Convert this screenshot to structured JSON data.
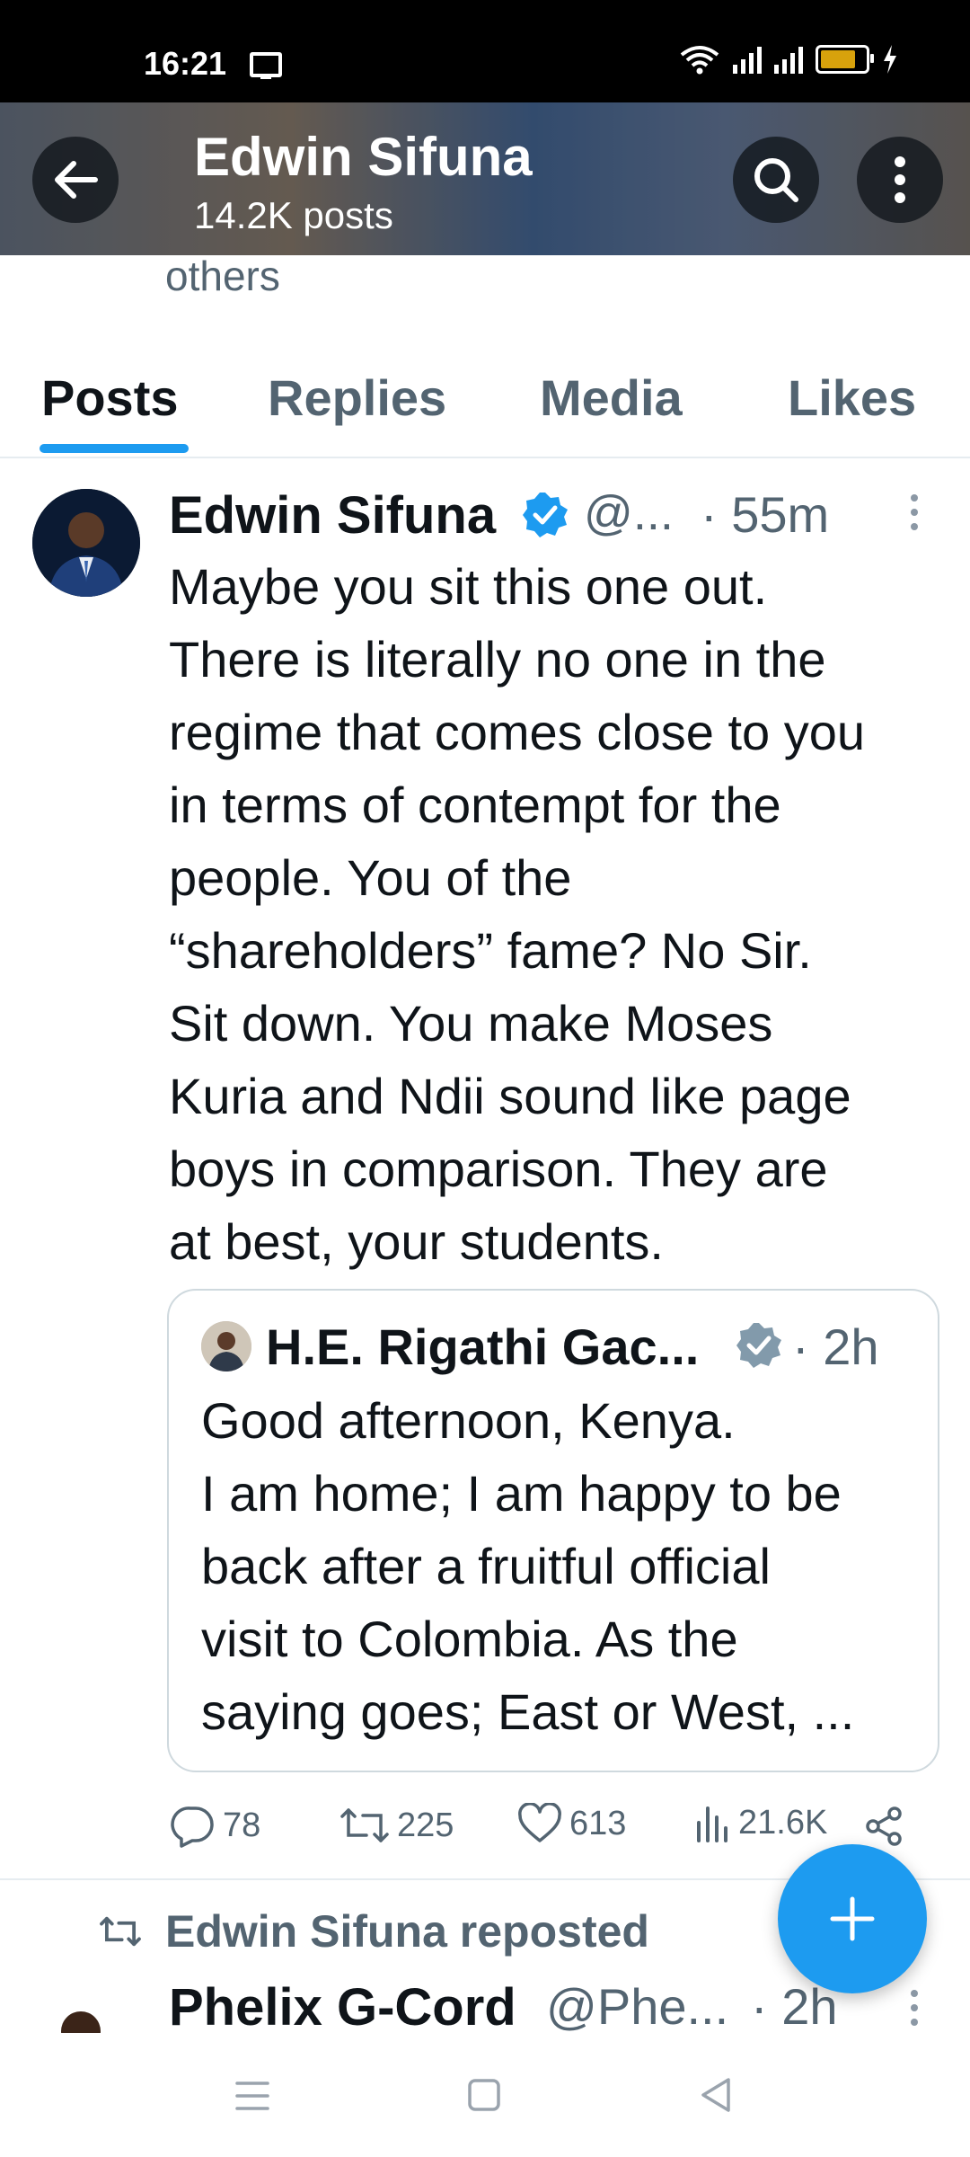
{
  "status_bar": {
    "time": "16:21",
    "battery_color": "#d8a20c"
  },
  "header": {
    "name": "Edwin Sifuna",
    "posts_count": "14.2K posts",
    "bio_fragment": "others"
  },
  "tabs": [
    {
      "label": "Posts",
      "active": true
    },
    {
      "label": "Replies",
      "active": false
    },
    {
      "label": "Media",
      "active": false
    },
    {
      "label": "Likes",
      "active": false
    }
  ],
  "tweet": {
    "author_name": "Edwin Sifuna",
    "handle": "@...",
    "time": "· 55m",
    "text": "Maybe you sit this one out.\nThere is literally no one in the\nregime that comes close to you\nin terms of contempt for the\npeople. You of the\n“shareholders” fame? No Sir.\nSit down. You make Moses\nKuria and Ndii sound like page\nboys in comparison. They are\nat best, your students.",
    "quote": {
      "author_name": "H.E. Rigathi Gac...",
      "time": "· 2h",
      "text": "Good afternoon, Kenya.\nI am home; I am happy to be\nback after a fruitful official\nvisit to Colombia.  As the\nsaying goes; East or West, ..."
    },
    "stats": {
      "replies": "78",
      "reposts": "225",
      "likes": "613",
      "views": "21.6K"
    }
  },
  "next_tweet": {
    "repost_label": "Edwin Sifuna reposted",
    "author_name": "Phelix G-Cord",
    "handle": "@Phe...",
    "time": "· 2h"
  },
  "colors": {
    "accent": "#1d9bf0",
    "text": "#0f1419",
    "muted": "#536471",
    "border": "#cfd9de"
  }
}
